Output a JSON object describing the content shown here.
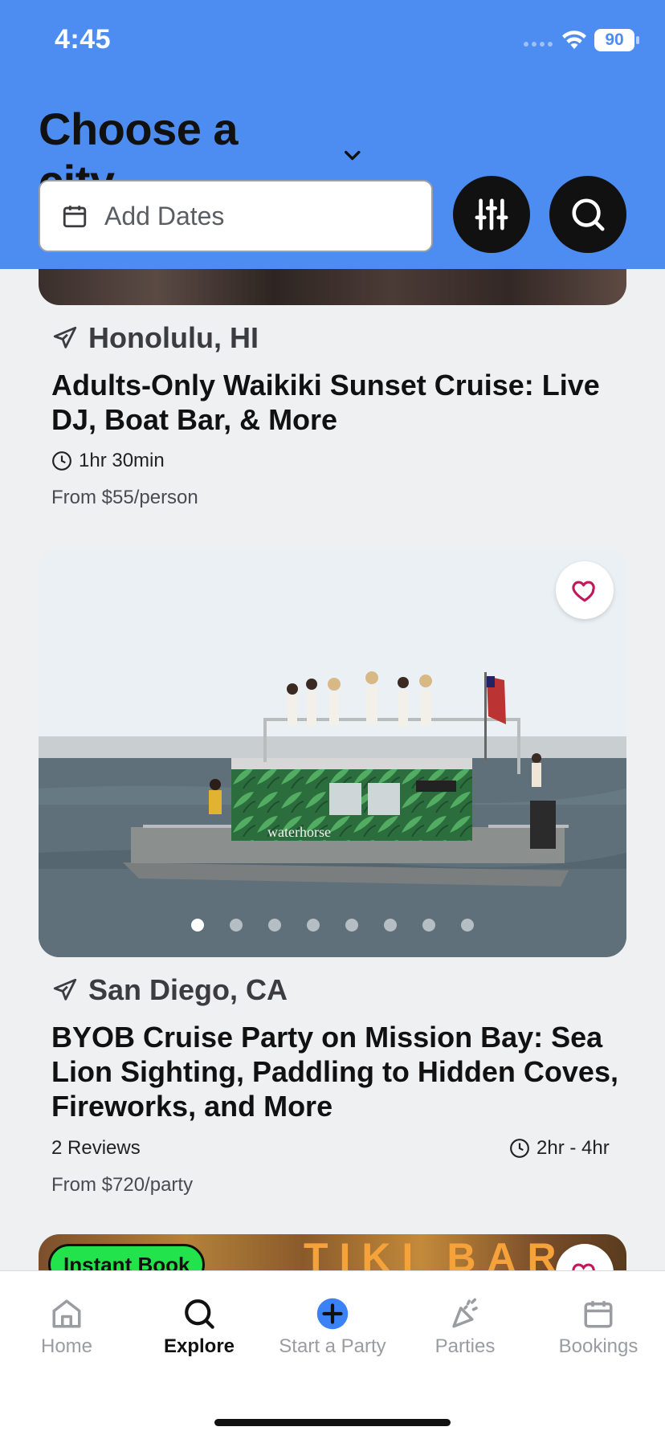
{
  "status_bar": {
    "time": "4:45",
    "battery": "90"
  },
  "header": {
    "city_title": "Choose a city",
    "date_placeholder": "Add Dates"
  },
  "cards": [
    {
      "location": "Honolulu, HI",
      "title": "Adults-Only Waikiki Sunset Cruise: Live DJ, Boat Bar, & More",
      "duration": "1hr 30min",
      "price": "From $55/person"
    },
    {
      "location": "San Diego, CA",
      "title": "BYOB Cruise Party on Mission Bay: Sea Lion Sighting, Paddling to Hidden Coves, Fireworks, and More",
      "reviews": "2 Reviews",
      "duration": "2hr - 4hr",
      "price": "From $720/party",
      "boat_brand": "waterhorse"
    },
    {
      "badge": "Instant Book",
      "sign_text": "TIKI BAR"
    }
  ],
  "tabs": [
    {
      "label": "Home",
      "icon": "home-icon"
    },
    {
      "label": "Explore",
      "icon": "search-icon"
    },
    {
      "label": "Start a Party",
      "icon": "plus-circle-icon"
    },
    {
      "label": "Parties",
      "icon": "party-popper-icon"
    },
    {
      "label": "Bookings",
      "icon": "calendar-icon"
    }
  ],
  "colors": {
    "header_blue": "#4d8df2",
    "accent_pink": "#c2185b",
    "badge_green": "#22e34b"
  }
}
